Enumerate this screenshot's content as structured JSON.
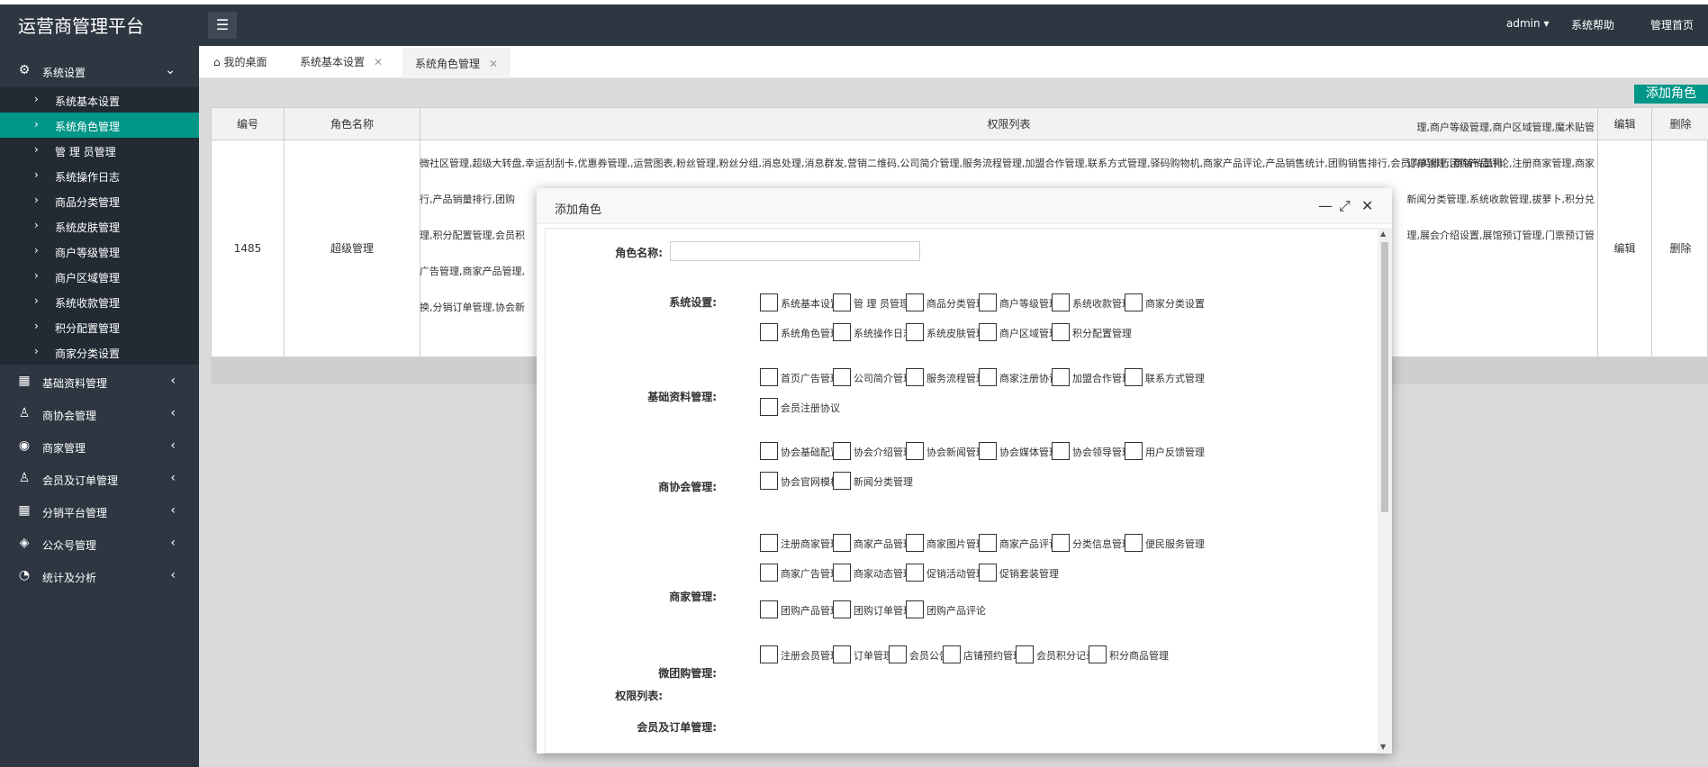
{
  "app": {
    "title": "运营商管理平台"
  },
  "topnav": {
    "user": "admin",
    "help": "系统帮助",
    "home": "管理首页"
  },
  "sidebar": {
    "system": "系统设置",
    "items": [
      "系统基本设置",
      "系统角色管理",
      "管 理 员管理",
      "系统操作日志",
      "商品分类管理",
      "系统皮肤管理",
      "商户等级管理",
      "商户区域管理",
      "系统收款管理",
      "积分配置管理",
      "商家分类设置"
    ],
    "groups": [
      "基础资料管理",
      "商协会管理",
      "商家管理",
      "会员及订单管理",
      "分销平台管理",
      "公众号管理",
      "统计及分析"
    ]
  },
  "tabs": [
    "我的桌面",
    "系统基本设置",
    "系统角色管理"
  ],
  "page": {
    "add_button": "添加角色",
    "headers": [
      "编号",
      "角色名称",
      "权限列表",
      "编辑",
      "删除"
    ],
    "row": {
      "id": "1485",
      "name": "超级管理",
      "edit": "编辑",
      "delete": "删除",
      "perm_lines": [
        "微社区管理,超级大转盘,幸运刮刮卡,优惠券管理,,运营图表,粉丝管理,粉丝分组,消息处理,消息群发,营销二维码,公司简介管理,服务流程管理,加盟合作管理,联系方式管理,驿码购物机,商家产品评论,产品销售统计,团购销售排行,会员购买排行,商铺销量排",
        "行,产品销量排行,团购",
        "理,积分配置管理,会员积",
        "广告管理,商家产品管理,",
        "换,分销订单管理,协会新"
      ],
      "perm_right_lines": [
        "",
        "",
        "理,商户等级管理,商户区域管理,魔术贴管",
        "订单管理,团购产品评论,注册商家管理,商家",
        "新闻分类管理,系统收款管理,拔萝卜,积分兑",
        "理,展会介绍设置,展馆预订管理,门票预订管"
      ]
    }
  },
  "modal": {
    "title": "添加角色",
    "name_label": "角色名称:",
    "perm_label": "权限列表:",
    "sections": [
      {
        "label": "系统设置:",
        "items": [
          "系统基本设置",
          "管 理 员管理",
          "商品分类管理",
          "商户等级管理",
          "系统收款管理",
          "商家分类设置",
          "系统角色管理",
          "系统操作日志",
          "系统皮肤管理",
          "商户区域管理",
          "积分配置管理"
        ]
      },
      {
        "label": "基础资料管理:",
        "items": [
          "首页广告管理",
          "公司简介管理",
          "服务流程管理",
          "商家注册协议",
          "加盟合作管理",
          "联系方式管理",
          "会员注册协议"
        ]
      },
      {
        "label": "商协会管理:",
        "items": [
          "协会基础配置",
          "协会介绍管理",
          "协会新闻管理",
          "协会媒体管理",
          "协会领导管理",
          "用户反馈管理",
          "协会官网模板",
          "新闻分类管理"
        ]
      },
      {
        "label": "商家管理:",
        "items": [
          "注册商家管理",
          "商家产品管理",
          "商家图片管理",
          "商家产品评论",
          "分类信息管理",
          "便民服务管理",
          "商家广告管理",
          "商家动态管理",
          "促销活动管理",
          "促销套装管理"
        ]
      },
      {
        "label": "微团购管理:",
        "items": [
          "团购产品管理",
          "团购订单管理",
          "团购产品评论"
        ]
      },
      {
        "label": "会员及订单管理:",
        "items": [
          "注册会员管理",
          "订单管理",
          "会员公告",
          "店铺预约管理",
          "会员积分记录",
          "积分商品管理"
        ]
      }
    ]
  },
  "colors": {
    "sidebar": "#2d3641",
    "accent": "#009688"
  }
}
